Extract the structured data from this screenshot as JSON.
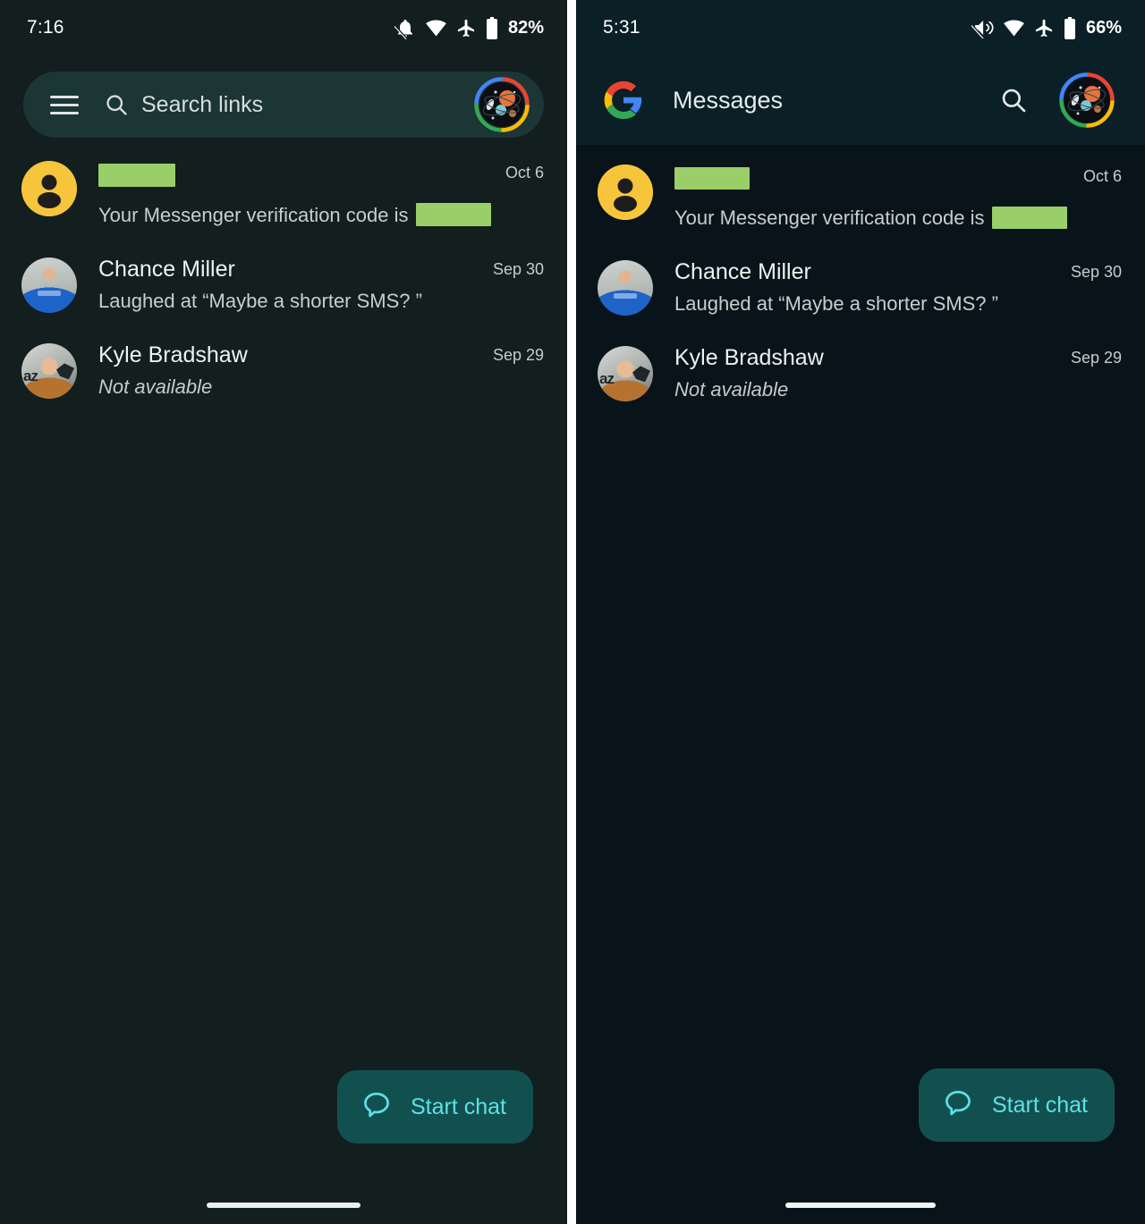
{
  "panels": {
    "left": {
      "status": {
        "clock": "7:16",
        "battery": "82%",
        "icons": [
          "notifications-off-icon",
          "wifi-icon",
          "airplane-mode-icon",
          "battery-icon"
        ]
      },
      "search": {
        "placeholder": "Search links",
        "menu_icon": "hamburger-menu-icon",
        "search_icon": "search-icon",
        "avatar": "account-avatar"
      },
      "conversations": [
        {
          "name": "",
          "name_redacted": true,
          "date": "Oct 6",
          "snippet_prefix": "Your Messenger verification code is",
          "snippet_redacted": true,
          "snippet_style": "normal",
          "avatar": "default-person-avatar"
        },
        {
          "name": "Chance Miller",
          "name_redacted": false,
          "date": "Sep 30",
          "snippet_prefix": "Laughed at “Maybe a shorter SMS? ”",
          "snippet_redacted": false,
          "snippet_style": "normal",
          "avatar": "photo-avatar-chance"
        },
        {
          "name": "Kyle Bradshaw",
          "name_redacted": false,
          "date": "Sep 29",
          "snippet_prefix": "Not available",
          "snippet_redacted": false,
          "snippet_style": "italic",
          "avatar": "photo-avatar-kyle"
        }
      ],
      "fab": {
        "label": "Start chat",
        "icon": "chat-bubble-icon"
      }
    },
    "right": {
      "status": {
        "clock": "5:31",
        "battery": "66%",
        "icons": [
          "volume-off-icon",
          "wifi-icon",
          "airplane-mode-icon",
          "battery-icon"
        ]
      },
      "appbar": {
        "title": "Messages",
        "logo": "google-g-logo",
        "search_icon": "search-icon",
        "avatar": "account-avatar"
      },
      "conversations": [
        {
          "name": "",
          "name_redacted": true,
          "date": "Oct 6",
          "snippet_prefix": "Your Messenger verification code is",
          "snippet_redacted": true,
          "snippet_style": "normal",
          "avatar": "default-person-avatar"
        },
        {
          "name": "Chance Miller",
          "name_redacted": false,
          "date": "Sep 30",
          "snippet_prefix": "Laughed at “Maybe a shorter SMS? ”",
          "snippet_redacted": false,
          "snippet_style": "normal",
          "avatar": "photo-avatar-chance"
        },
        {
          "name": "Kyle Bradshaw",
          "name_redacted": false,
          "date": "Sep 29",
          "snippet_prefix": "Not available",
          "snippet_redacted": false,
          "snippet_style": "italic",
          "avatar": "photo-avatar-kyle"
        }
      ],
      "fab": {
        "label": "Start chat",
        "icon": "chat-bubble-icon"
      }
    }
  },
  "colors": {
    "left_background": "#131e1e",
    "right_background": "#08141a",
    "right_appbar": "#0a1f26",
    "search_field": "#1b3634",
    "fab_background": "#12504f",
    "fab_accent": "#5ce1e6",
    "redaction_green": "#9ace68",
    "default_avatar_yellow": "#f7c53b"
  }
}
